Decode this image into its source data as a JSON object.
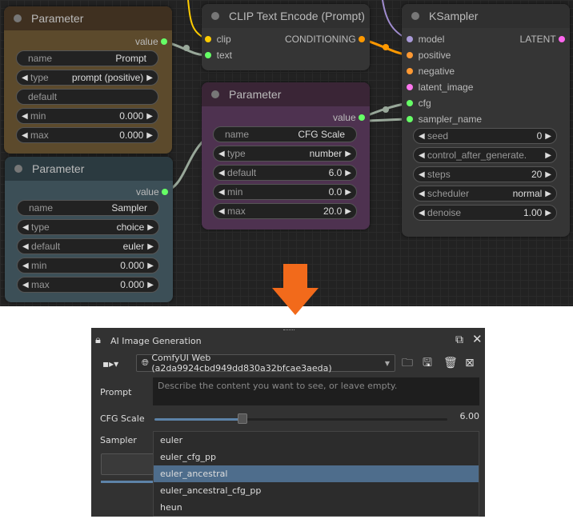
{
  "graph": {
    "param_prompt": {
      "title": "Parameter",
      "output": "value",
      "color": "#5c4a2c",
      "widgets": [
        {
          "label": "name",
          "value": "Prompt"
        },
        {
          "label": "type",
          "value": "prompt (positive)"
        },
        {
          "label": "default",
          "value": ""
        },
        {
          "label": "min",
          "value": "0.000"
        },
        {
          "label": "max",
          "value": "0.000"
        }
      ]
    },
    "param_sampler": {
      "title": "Parameter",
      "output": "value",
      "color": "#3c4f57",
      "widgets": [
        {
          "label": "name",
          "value": "Sampler"
        },
        {
          "label": "type",
          "value": "choice"
        },
        {
          "label": "default",
          "value": "euler"
        },
        {
          "label": "min",
          "value": "0.000"
        },
        {
          "label": "max",
          "value": "0.000"
        }
      ]
    },
    "clip": {
      "title": "CLIP Text Encode (Prompt)",
      "inputs": [
        "clip",
        "text"
      ],
      "output": "CONDITIONING"
    },
    "param_cfg": {
      "title": "Parameter",
      "output": "value",
      "color": "#4e3250",
      "widgets": [
        {
          "label": "name",
          "value": "CFG Scale"
        },
        {
          "label": "type",
          "value": "number"
        },
        {
          "label": "default",
          "value": "6.0"
        },
        {
          "label": "min",
          "value": "0.0"
        },
        {
          "label": "max",
          "value": "20.0"
        }
      ]
    },
    "ksampler": {
      "title": "KSampler",
      "inputs": [
        "model",
        "positive",
        "negative",
        "latent_image",
        "cfg",
        "sampler_name"
      ],
      "output": "LATENT",
      "widgets": [
        {
          "label": "seed",
          "value": "0"
        },
        {
          "label": "control_after_generate.",
          "value": ""
        },
        {
          "label": "steps",
          "value": "20"
        },
        {
          "label": "scheduler",
          "value": "normal"
        },
        {
          "label": "denoise",
          "value": "1.00"
        }
      ]
    }
  },
  "panel": {
    "title": "AI Image Generation",
    "connection": "ComfyUI Web (a2da9924cbd949dd830a32bfcae3aeda)",
    "prompt_label": "Prompt",
    "prompt_placeholder": "Describe the content you want to see, or leave empty.",
    "cfg_label": "CFG Scale",
    "cfg_value": "6.00",
    "cfg_fraction": 0.3,
    "sampler_label": "Sampler",
    "sampler_options": [
      "euler",
      "euler_cfg_pp",
      "euler_ancestral",
      "euler_ancestral_cfg_pp",
      "heun"
    ],
    "selected_option": "euler_ancestral"
  }
}
